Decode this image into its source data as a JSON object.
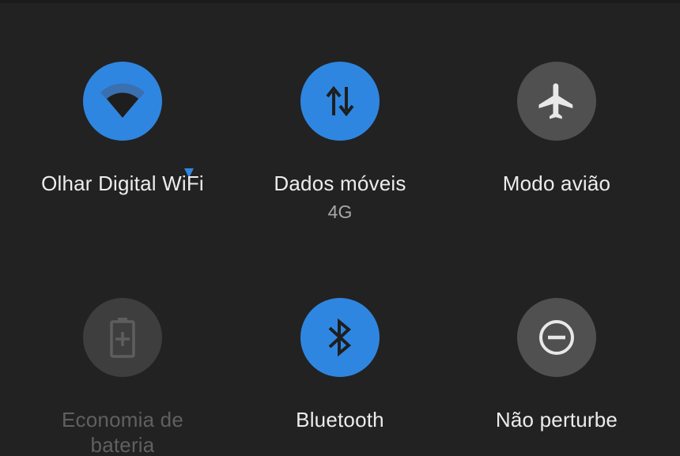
{
  "colors": {
    "background": "#222222",
    "active": "#2f86e0",
    "inactive": "#505050",
    "disabled": "#3e3e3e",
    "icon_dark": "#1e1e1e",
    "icon_light": "#e8e8e8",
    "label": "#ececec",
    "label_disabled": "#606060",
    "sublabel": "#a8a8a8"
  },
  "tiles": [
    {
      "id": "wifi",
      "label": "Olhar Digital WiFi",
      "state": "on",
      "icon": "wifi-icon",
      "has_expand": true
    },
    {
      "id": "mobile-data",
      "label": "Dados móveis",
      "sublabel": "4G",
      "state": "on",
      "icon": "data-transfer-icon"
    },
    {
      "id": "airplane",
      "label": "Modo avião",
      "state": "off",
      "icon": "airplane-icon"
    },
    {
      "id": "battery-saver",
      "label_line1": "Economia de",
      "label_line2": "bateria",
      "state": "disabled",
      "icon": "battery-plus-icon"
    },
    {
      "id": "bluetooth",
      "label": "Bluetooth",
      "state": "on",
      "icon": "bluetooth-icon"
    },
    {
      "id": "dnd",
      "label": "Não perturbe",
      "state": "off",
      "icon": "do-not-disturb-icon"
    }
  ]
}
